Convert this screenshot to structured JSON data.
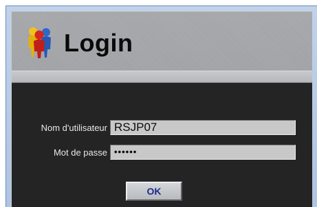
{
  "login": {
    "title": "Login",
    "icon": "users-group-icon",
    "username_label": "Nom d'utilisateur",
    "username_value": "RSJP07",
    "password_label": "Mot de passe",
    "password_value": "••••••",
    "ok_label": "OK"
  },
  "colors": {
    "window_border": "#6d8db3",
    "window_bg": "#b4c8e6",
    "panel_bg": "#9fa1a4",
    "form_bg": "#242424",
    "field_bg": "#c8c8c8",
    "button_text": "#1b2a8f"
  }
}
